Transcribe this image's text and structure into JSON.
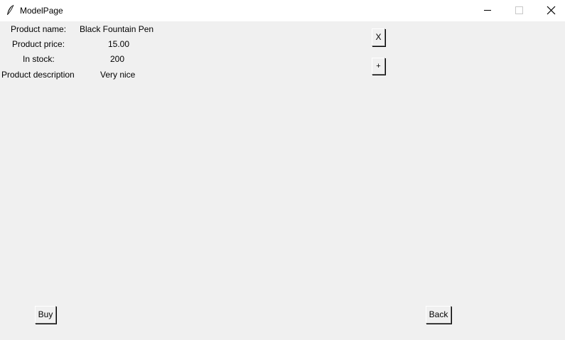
{
  "window": {
    "title": "ModelPage",
    "icon": "feather-icon"
  },
  "product": {
    "name_label": "Product name:",
    "name_value": "Black Fountain Pen",
    "price_label": "Product price:",
    "price_value": "15.00",
    "stock_label": "In stock:",
    "stock_value": "200",
    "description_label": "Product description",
    "description_value": "Very nice"
  },
  "buttons": {
    "close_label": "X",
    "add_label": "+",
    "buy_label": "Buy",
    "back_label": "Back"
  }
}
